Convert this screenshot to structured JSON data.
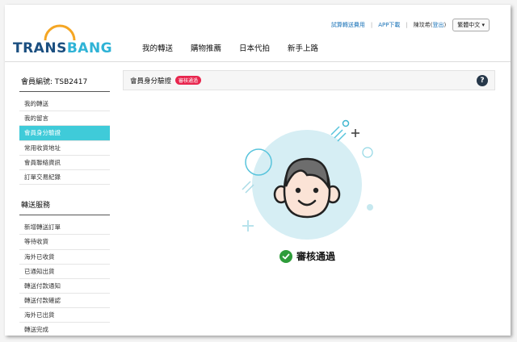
{
  "brand": {
    "logo_part1": "TRANS",
    "logo_part2": "BANG",
    "primary_color": "#1b4f80",
    "accent_color": "#2fb3d6"
  },
  "utility_nav": {
    "shipping_fee": "試算轉送費用",
    "app_download": "APP下載",
    "user_name": "陳玟希",
    "logout_prefix": "(",
    "logout": "登出",
    "logout_suffix": ")",
    "language": "繁體中文"
  },
  "main_nav": [
    "我的轉送",
    "購物推薦",
    "日本代拍",
    "新手上路"
  ],
  "sidebar": {
    "member_id": "會員編號: TSB2417",
    "account_items": [
      {
        "label": "我的轉送",
        "active": false
      },
      {
        "label": "我的留言",
        "active": false
      },
      {
        "label": "會員身分驗證",
        "active": true
      },
      {
        "label": "常用收貨地址",
        "active": false
      },
      {
        "label": "會員聯絡資訊",
        "active": false
      },
      {
        "label": "訂單交易紀錄",
        "active": false
      }
    ],
    "service_title": "轉送服務",
    "service_items": [
      {
        "label": "新增轉送訂單"
      },
      {
        "label": "等待收貨"
      },
      {
        "label": "海外已收貨"
      },
      {
        "label": "已通知出貨"
      },
      {
        "label": "轉送付款通知"
      },
      {
        "label": "轉送付款確認"
      },
      {
        "label": "海外已出貨"
      },
      {
        "label": "轉送完成"
      }
    ]
  },
  "verification": {
    "title": "會員身分驗證",
    "status_badge": "審核通過",
    "help": "?",
    "result_text": "審核通過",
    "badge_color": "#e8264e",
    "success_color": "#2e9c3a"
  }
}
